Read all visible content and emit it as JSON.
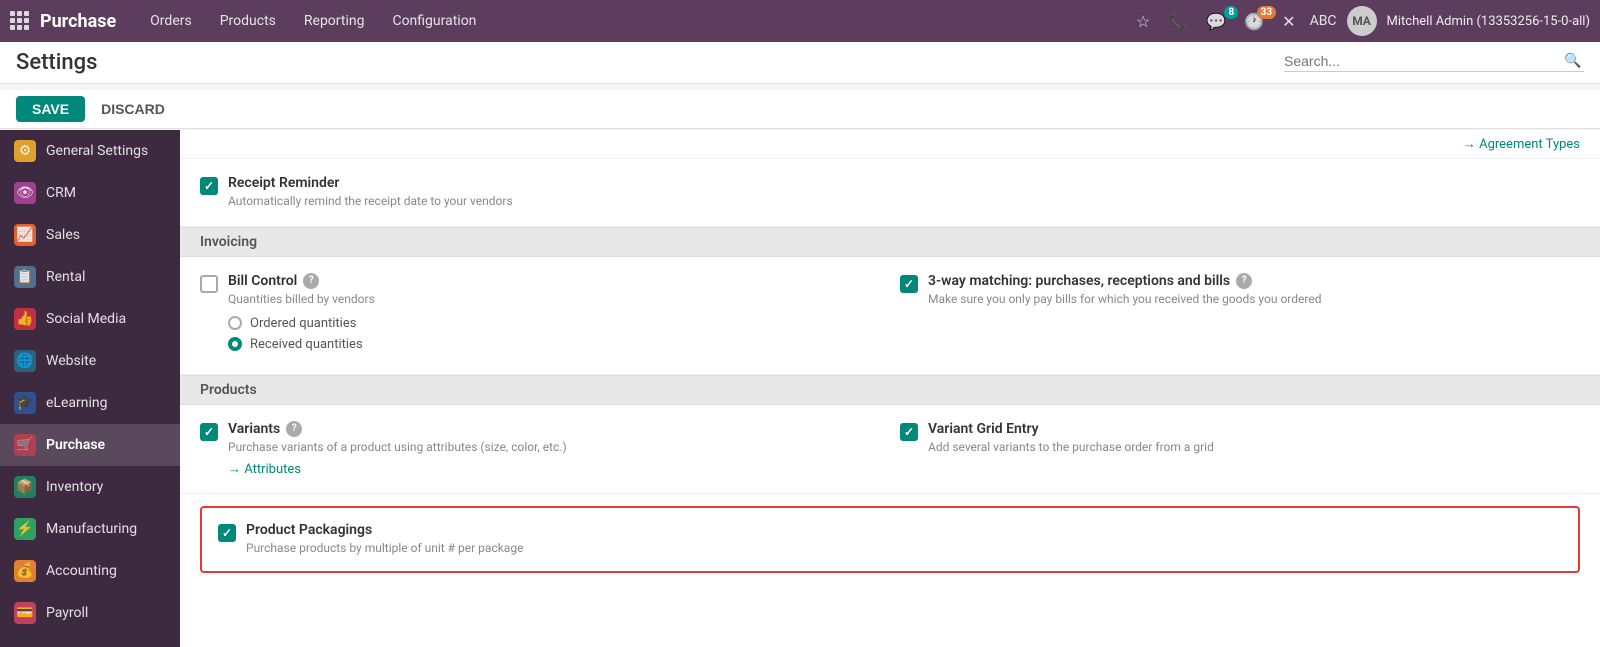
{
  "navbar": {
    "brand": "Purchase",
    "nav_items": [
      "Orders",
      "Products",
      "Reporting",
      "Configuration"
    ],
    "badge_messages": "8",
    "badge_clock": "33",
    "user_initials": "ABC",
    "user_name": "Mitchell Admin (13353256-15-0-all)"
  },
  "page": {
    "title": "Settings",
    "search_placeholder": "Search..."
  },
  "buttons": {
    "save": "SAVE",
    "discard": "DISCARD"
  },
  "sidebar": {
    "items": [
      {
        "label": "General Settings",
        "icon": "⚙",
        "class": "icon-general"
      },
      {
        "label": "CRM",
        "icon": "👁",
        "class": "icon-crm"
      },
      {
        "label": "Sales",
        "icon": "📈",
        "class": "icon-sales"
      },
      {
        "label": "Rental",
        "icon": "📋",
        "class": "icon-rental"
      },
      {
        "label": "Social Media",
        "icon": "👍",
        "class": "icon-social"
      },
      {
        "label": "Website",
        "icon": "🌐",
        "class": "icon-website"
      },
      {
        "label": "eLearning",
        "icon": "🎓",
        "class": "icon-elearning"
      },
      {
        "label": "Purchase",
        "icon": "🛒",
        "class": "icon-purchase",
        "active": true
      },
      {
        "label": "Inventory",
        "icon": "📦",
        "class": "icon-inventory"
      },
      {
        "label": "Manufacturing",
        "icon": "⚡",
        "class": "icon-manufacturing"
      },
      {
        "label": "Accounting",
        "icon": "💰",
        "class": "icon-accounting"
      },
      {
        "label": "Payroll",
        "icon": "💳",
        "class": "icon-payroll"
      }
    ]
  },
  "content": {
    "top_link": "Agreement Types",
    "sections": [
      {
        "title": "",
        "settings": [
          {
            "left": {
              "checked": true,
              "title": "Receipt Reminder",
              "desc": "Automatically remind the receipt date to your vendors",
              "link": null
            },
            "right": null
          }
        ]
      },
      {
        "title": "Invoicing",
        "settings": [
          {
            "left": {
              "checked": false,
              "title": "Bill Control",
              "info": true,
              "desc": "Quantities billed by vendors",
              "radios": [
                {
                  "label": "Ordered quantities",
                  "selected": false
                },
                {
                  "label": "Received quantities",
                  "selected": true
                }
              ]
            },
            "right": {
              "checked": true,
              "title": "3-way matching: purchases, receptions and bills",
              "info": true,
              "desc": "Make sure you only pay bills for which you received the goods you ordered"
            }
          }
        ]
      },
      {
        "title": "Products",
        "settings": [
          {
            "left": {
              "checked": true,
              "title": "Variants",
              "info": true,
              "desc": "Purchase variants of a product using attributes (size, color, etc.)",
              "link": "Attributes"
            },
            "right": {
              "checked": true,
              "title": "Variant Grid Entry",
              "desc": "Add several variants to the purchase order from a grid"
            }
          }
        ]
      }
    ],
    "highlighted": {
      "checked": true,
      "title": "Product Packagings",
      "desc": "Purchase products by multiple of unit # per package"
    }
  }
}
